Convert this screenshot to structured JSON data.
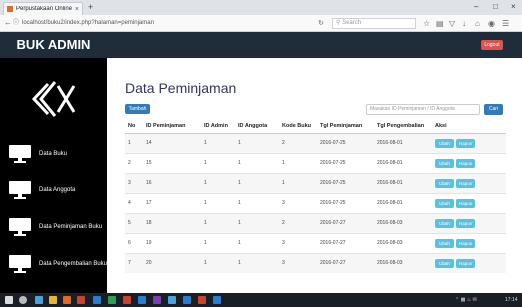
{
  "browser": {
    "tab_title": "Perpustakaan Online",
    "tab_close": "×",
    "new_tab": "+",
    "url": "localhost/buku2/index.php?halaman=peminjaman",
    "search_placeholder": "Search",
    "minimize": "–",
    "maximize": "□",
    "close": "×"
  },
  "app": {
    "brand": "BUK ADMIN",
    "logout_label": "Logout",
    "page_title": "Data Peminjaman",
    "add_label": "Tambah",
    "search_placeholder": "Masukan ID Peminjaman / ID Anggota",
    "search_button": "Cari"
  },
  "sidebar": {
    "items": [
      {
        "label": "Data Buku"
      },
      {
        "label": "Data Anggota"
      },
      {
        "label": "Data Peminjaman Buku"
      },
      {
        "label": "Data Pengembalian Buku"
      }
    ]
  },
  "table": {
    "headers": [
      "No",
      "ID Peminjaman",
      "ID Admin",
      "ID Anggota",
      "Kode Buku",
      "Tgl Peminjaman",
      "Tgl Pengembalian",
      "Aksi"
    ],
    "action_edit": "Ubah",
    "action_delete": "Hapus",
    "rows": [
      [
        "1",
        "14",
        "1",
        "1",
        "2",
        "2016-07-25",
        "2016-08-01"
      ],
      [
        "2",
        "15",
        "1",
        "1",
        "1",
        "2016-07-25",
        "2016-08-01"
      ],
      [
        "3",
        "16",
        "1",
        "1",
        "1",
        "2016-07-25",
        "2016-08-01"
      ],
      [
        "4",
        "17",
        "1",
        "1",
        "3",
        "2016-07-25",
        "2016-08-01"
      ],
      [
        "5",
        "18",
        "1",
        "1",
        "2",
        "2016-07-27",
        "2016-08-03"
      ],
      [
        "6",
        "19",
        "1",
        "1",
        "3",
        "2016-07-27",
        "2016-08-03"
      ],
      [
        "7",
        "20",
        "1",
        "1",
        "3",
        "2016-07-27",
        "2016-08-03"
      ]
    ]
  },
  "taskbar": {
    "clock": "17:14"
  },
  "colors": {
    "accent": "#337ab7",
    "action": "#5bc0de",
    "danger": "#d9534f",
    "header_bar": "#1f2d3a"
  }
}
